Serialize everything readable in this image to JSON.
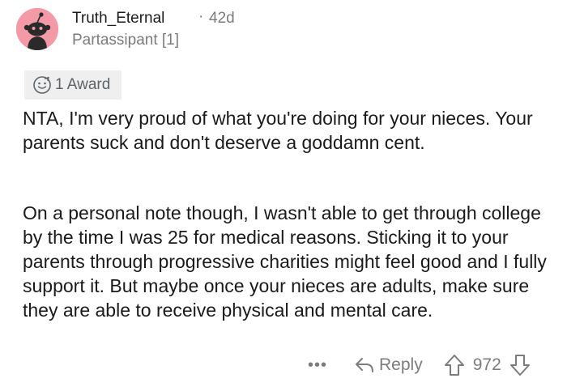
{
  "comment": {
    "username": "Truth_Eternal",
    "separator": "·",
    "age": "42d",
    "flair": "Partassipant [1]",
    "avatar_icon": "snoo-avatar-icon",
    "avatar_color": "#f39aa6",
    "award": {
      "icon": "award-icon",
      "label": "1 Award"
    },
    "paragraphs": [
      "NTA, I'm very proud of what you're doing for your nieces. Your parents suck and don't deserve a goddamn cent.",
      "On a personal note though, I wasn't able to get through college by the time I was 25 for medical reasons. Sticking it to your parents through progressive charities might feel good and I fully support it. But maybe once your nieces are adults, make sure they are able to receive physical and mental care."
    ]
  },
  "actions": {
    "more_label": "•••",
    "reply_icon": "reply-arrow-icon",
    "reply_label": "Reply",
    "upvote_icon": "upvote-arrow-icon",
    "score": "972",
    "downvote_icon": "downvote-arrow-icon"
  }
}
